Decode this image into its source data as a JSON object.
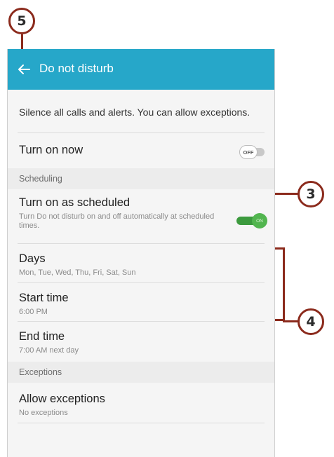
{
  "callouts": {
    "back": "5",
    "toggle": "3",
    "schedule": "4"
  },
  "appbar": {
    "title": "Do not disturb",
    "back_icon": "arrow-left-icon",
    "color": "#26a7c9"
  },
  "description": "Silence all calls and alerts. You can allow exceptions.",
  "turn_on_now": {
    "label": "Turn on now",
    "toggle_state": "OFF"
  },
  "sections": {
    "scheduling": "Scheduling",
    "exceptions": "Exceptions"
  },
  "turn_on_scheduled": {
    "label": "Turn on as scheduled",
    "description": "Turn Do not disturb on and off automatically at scheduled times.",
    "toggle_state": "ON",
    "accent": "#52b54f"
  },
  "days": {
    "label": "Days",
    "value": "Mon, Tue, Wed, Thu, Fri, Sat, Sun"
  },
  "start_time": {
    "label": "Start time",
    "value": "6:00 PM"
  },
  "end_time": {
    "label": "End time",
    "value": "7:00 AM next day"
  },
  "allow_exceptions": {
    "label": "Allow exceptions",
    "value": "No exceptions"
  },
  "annotation_color": "#8b2a1c"
}
